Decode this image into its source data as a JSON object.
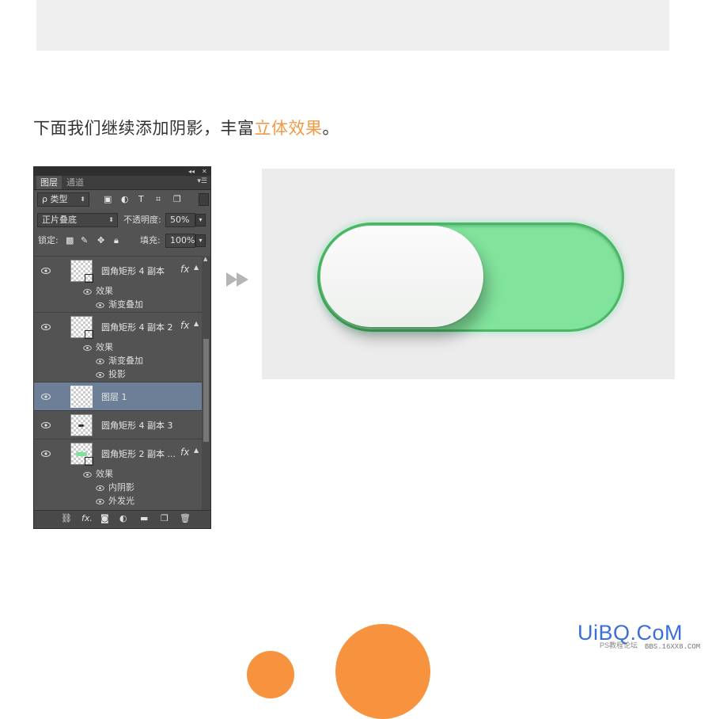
{
  "caption": {
    "main": "下面我们继续添加阴影，丰富",
    "highlight": "立体效果",
    "end": "。"
  },
  "panel": {
    "tabs": [
      "图层",
      "通道"
    ],
    "filter_label": "ρ 类型",
    "blend_mode": "正片叠底",
    "opacity_label": "不透明度:",
    "opacity_value": "50%",
    "lock_label": "锁定:",
    "fill_label": "填充:",
    "fill_value": "100%",
    "layers": [
      {
        "name": "圆角矩形 4 副本",
        "fx": "fx",
        "effects_label": "效果",
        "effects": [
          "渐变叠加"
        ]
      },
      {
        "name": "圆角矩形 4 副本 2",
        "fx": "fx",
        "effects_label": "效果",
        "effects": [
          "渐变叠加",
          "投影"
        ]
      },
      {
        "name": "图层 1",
        "selected": true
      },
      {
        "name": "圆角矩形 4 副本 3"
      },
      {
        "name": "圆角矩形 2 副本 ...",
        "fx": "fx",
        "effects_label": "效果",
        "effects": [
          "内阴影",
          "外发光"
        ]
      }
    ],
    "bottom_icons": [
      "link-icon",
      "fx-icon",
      "mask-icon",
      "adjustment-icon",
      "folder-icon",
      "new-layer-icon",
      "trash-icon"
    ],
    "fx_text": "fx."
  },
  "preview": {
    "track_color": "#82e39c",
    "track_border": "#48b863",
    "knob_color": "#f4f5f4"
  },
  "watermark": {
    "logo": "UiBQ.CoM",
    "sub1": "PS教程论坛",
    "sub2": "BBS.16XX8.COM"
  },
  "colors": {
    "highlight": "#f09a45",
    "accent_orange": "#f7933e",
    "panel_bg": "#535353",
    "selected_layer": "#6c7f96"
  }
}
